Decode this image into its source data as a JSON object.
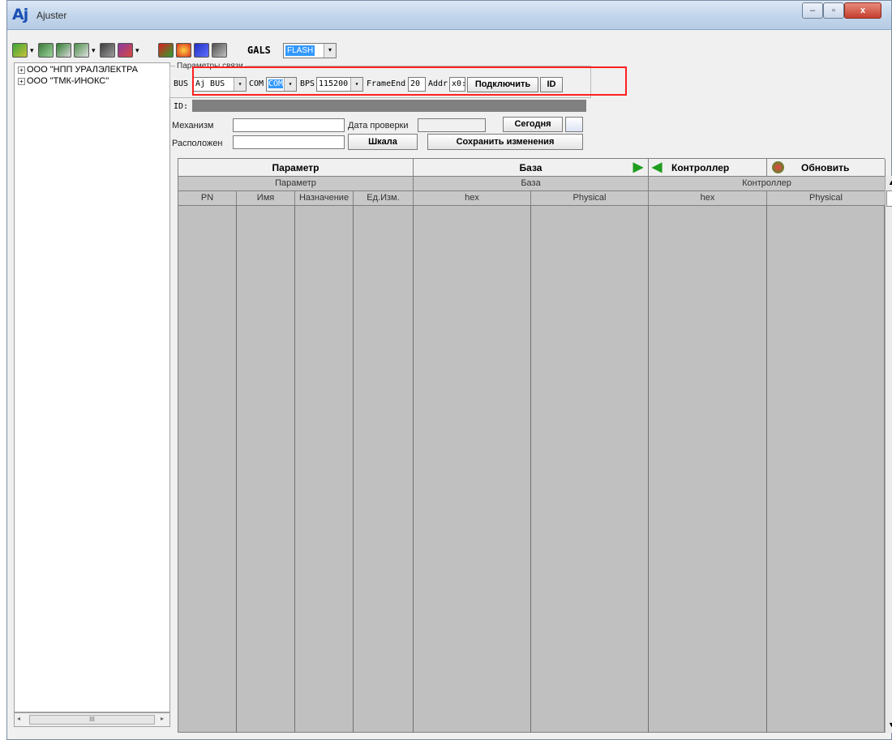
{
  "window": {
    "icon_text": "Aj",
    "title": "Ajuster",
    "controls": {
      "minimize": "–",
      "maximize": "▫",
      "close": "x"
    }
  },
  "toolbar": {
    "gals_label": "GALS",
    "flash_value": "FLASH",
    "drop_arrow": "▾",
    "icons": [
      "tree-icon",
      "module-icon",
      "chart-icon",
      "monitor-icon",
      "settings-icon",
      "palette-icon",
      "grid-icon",
      "info-icon",
      "book-icon",
      "shield-icon"
    ]
  },
  "tree": {
    "items": [
      {
        "expander": "+",
        "label": "ООО \"НПП УРАЛЭЛЕКТРА"
      },
      {
        "expander": "+",
        "label": "ООО \"ТМК-ИНОКС\""
      }
    ],
    "scroll_thumb": "III"
  },
  "connection": {
    "legend": "Параметры связи",
    "bus_label": "BUS",
    "bus_value": "Aj BUS",
    "com_label": "COM",
    "com_value": "COM",
    "bps_label": "BPS",
    "bps_value": "115200",
    "frameend_label": "FrameEnd",
    "frameend_value": "20",
    "addr_label": "Addr",
    "addr_value": "x0:",
    "connect_button": "Подключить",
    "id_button": "ID"
  },
  "device": {
    "id_label": "ID:",
    "mechanism_label": "Механизм",
    "location_label": "Расположен",
    "check_date_label": "Дата проверки",
    "today_button": "Сегодня",
    "scale_button": "Шкала",
    "save_button": "Сохранить изменения"
  },
  "grid": {
    "top_headers": {
      "parameter": "Параметр",
      "base": "База",
      "controller": "Контроллер",
      "refresh": "Обновить"
    },
    "group_headers": [
      "Параметр",
      "База",
      "Контроллер"
    ],
    "columns": [
      "PN",
      "Имя",
      "Назначение",
      "Ед.Изм.",
      "hex",
      "Physical",
      "hex",
      "Physical"
    ],
    "rows": []
  },
  "colors": {
    "selection": "#3399ff",
    "highlight_box": "#ff2020",
    "grid_background": "#c0c0c0",
    "arrow_green": "#1f9e1f"
  }
}
